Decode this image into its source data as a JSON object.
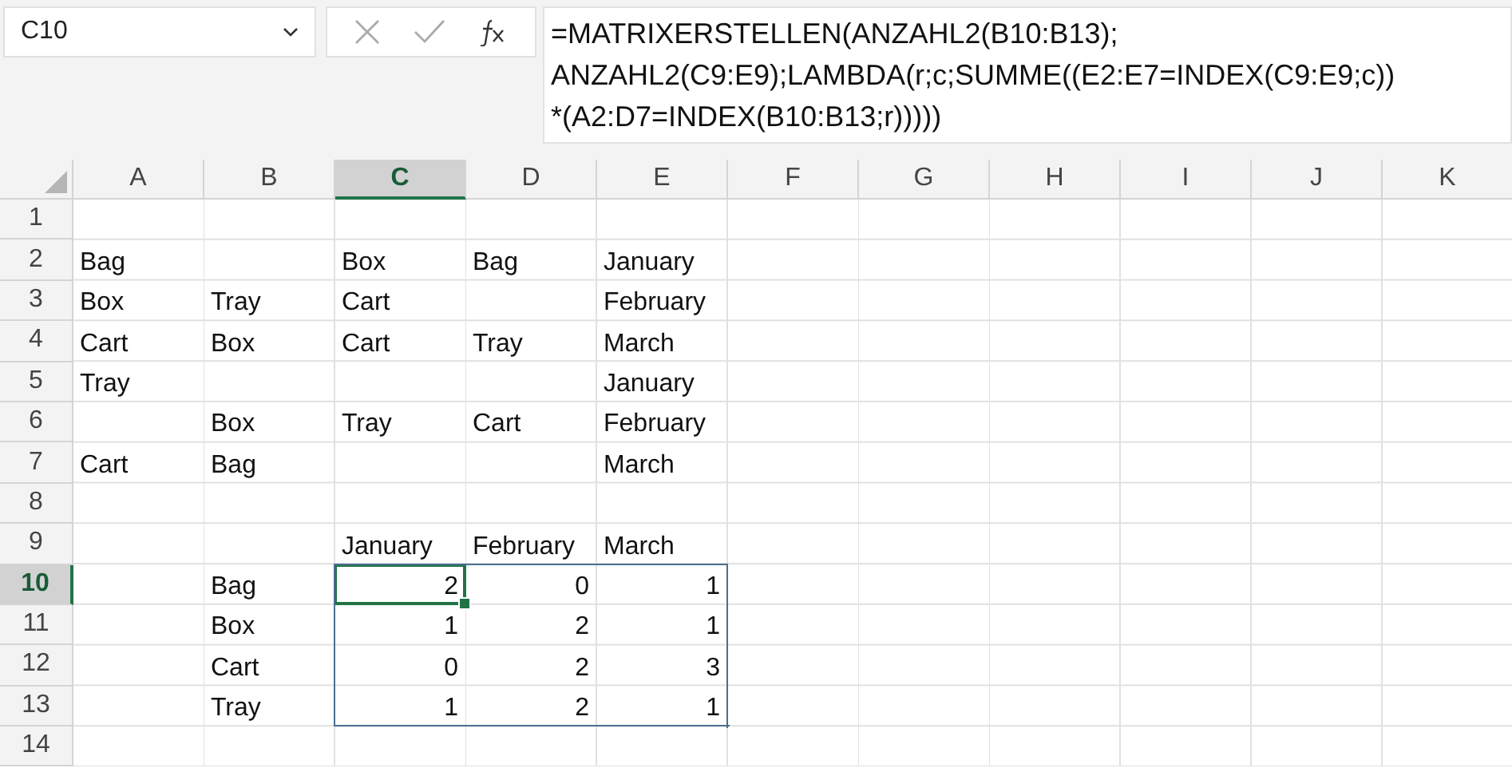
{
  "name_box": {
    "value": "C10"
  },
  "formula_bar": {
    "lines": [
      "=MATRIXERSTELLEN(ANZAHL2(B10:B13);",
      "ANZAHL2(C9:E9);LAMBDA(r;c;SUMME((E2:E7=INDEX(C9:E9;c))",
      "*(A2:D7=INDEX(B10:B13;r)))))"
    ]
  },
  "columns": [
    {
      "label": "A",
      "selected": false
    },
    {
      "label": "B",
      "selected": false
    },
    {
      "label": "C",
      "selected": true
    },
    {
      "label": "D",
      "selected": false
    },
    {
      "label": "E",
      "selected": false
    },
    {
      "label": "F",
      "selected": false
    },
    {
      "label": "G",
      "selected": false
    },
    {
      "label": "H",
      "selected": false
    },
    {
      "label": "I",
      "selected": false
    },
    {
      "label": "J",
      "selected": false
    },
    {
      "label": "K",
      "selected": false
    }
  ],
  "rows": [
    {
      "label": "1",
      "selected": false,
      "cells": []
    },
    {
      "label": "2",
      "selected": false,
      "cells": [
        {
          "kind": "text",
          "text": "Bag"
        },
        null,
        {
          "kind": "text",
          "text": "Box"
        },
        {
          "kind": "text",
          "text": "Bag"
        },
        {
          "kind": "text",
          "text": "January"
        }
      ]
    },
    {
      "label": "3",
      "selected": false,
      "cells": [
        {
          "kind": "text",
          "text": "Box"
        },
        {
          "kind": "text",
          "text": "Tray"
        },
        {
          "kind": "text",
          "text": "Cart"
        },
        null,
        {
          "kind": "text",
          "text": "February"
        }
      ]
    },
    {
      "label": "4",
      "selected": false,
      "cells": [
        {
          "kind": "text",
          "text": "Cart"
        },
        {
          "kind": "text",
          "text": "Box"
        },
        {
          "kind": "text",
          "text": "Cart"
        },
        {
          "kind": "text",
          "text": "Tray"
        },
        {
          "kind": "text",
          "text": "March"
        }
      ]
    },
    {
      "label": "5",
      "selected": false,
      "cells": [
        {
          "kind": "text",
          "text": "Tray"
        },
        null,
        null,
        null,
        {
          "kind": "text",
          "text": "January"
        }
      ]
    },
    {
      "label": "6",
      "selected": false,
      "cells": [
        null,
        {
          "kind": "text",
          "text": "Box"
        },
        {
          "kind": "text",
          "text": "Tray"
        },
        {
          "kind": "text",
          "text": "Cart"
        },
        {
          "kind": "text",
          "text": "February"
        }
      ]
    },
    {
      "label": "7",
      "selected": false,
      "cells": [
        {
          "kind": "text",
          "text": "Cart"
        },
        {
          "kind": "text",
          "text": "Bag"
        },
        null,
        null,
        {
          "kind": "text",
          "text": "March"
        }
      ]
    },
    {
      "label": "8",
      "selected": false,
      "cells": []
    },
    {
      "label": "9",
      "selected": false,
      "cells": [
        null,
        null,
        {
          "kind": "text",
          "text": "January"
        },
        {
          "kind": "text",
          "text": "February"
        },
        {
          "kind": "text",
          "text": "March"
        }
      ]
    },
    {
      "label": "10",
      "selected": true,
      "cells": [
        null,
        {
          "kind": "text",
          "text": "Bag"
        },
        {
          "kind": "spill",
          "text": "2",
          "active": true
        },
        {
          "kind": "spill",
          "text": "0",
          "active": false
        },
        {
          "kind": "spill",
          "text": "1",
          "active": false
        }
      ]
    },
    {
      "label": "11",
      "selected": false,
      "cells": [
        null,
        {
          "kind": "text",
          "text": "Box"
        },
        {
          "kind": "spill",
          "text": "1",
          "active": false
        },
        {
          "kind": "spill",
          "text": "2",
          "active": false
        },
        {
          "kind": "spill",
          "text": "1",
          "active": false
        }
      ]
    },
    {
      "label": "12",
      "selected": false,
      "cells": [
        null,
        {
          "kind": "text",
          "text": "Cart"
        },
        {
          "kind": "spill",
          "text": "0",
          "active": false
        },
        {
          "kind": "spill",
          "text": "2",
          "active": false
        },
        {
          "kind": "spill",
          "text": "3",
          "active": false
        }
      ]
    },
    {
      "label": "13",
      "selected": false,
      "cells": [
        null,
        {
          "kind": "text",
          "text": "Tray"
        },
        {
          "kind": "spill",
          "text": "1",
          "active": false
        },
        {
          "kind": "spill",
          "text": "2",
          "active": false
        },
        {
          "kind": "spill",
          "text": "1",
          "active": false
        }
      ]
    },
    {
      "label": "14",
      "selected": false,
      "cells": []
    }
  ]
}
